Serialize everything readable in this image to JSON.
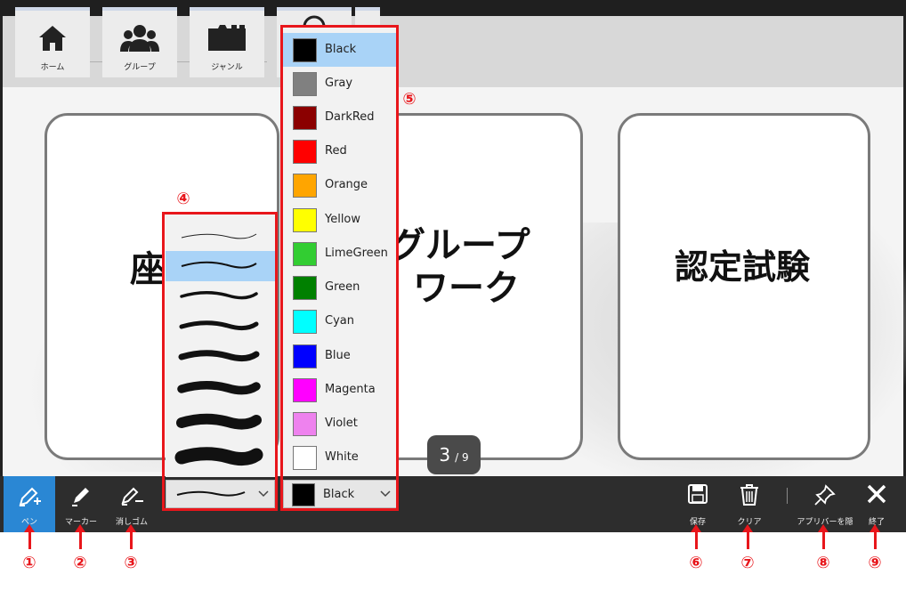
{
  "nav": {
    "home_label": "ホーム",
    "group_label": "グループ",
    "genre_label": "ジャンル"
  },
  "slide": {
    "card1_text": "座",
    "card2_line1": "グループ",
    "card2_line2": "ワーク",
    "card3_text": "認定試験"
  },
  "pager": {
    "current": "3",
    "total": "/ 9"
  },
  "toolbar": {
    "pen_label": "ペン",
    "marker_label": "マーカー",
    "eraser_label": "消しゴム",
    "save_label": "保存",
    "clear_label": "クリア",
    "hide_appbar_label": "アプリバーを隠",
    "exit_label": "終了"
  },
  "pen_width": {
    "selected_index": 1,
    "count": 8
  },
  "colors": {
    "selected": "Black",
    "dropdown_label": "Black",
    "items": [
      {
        "name": "Black",
        "hex": "#000000"
      },
      {
        "name": "Gray",
        "hex": "#808080"
      },
      {
        "name": "DarkRed",
        "hex": "#8b0000"
      },
      {
        "name": "Red",
        "hex": "#ff0000"
      },
      {
        "name": "Orange",
        "hex": "#ffa500"
      },
      {
        "name": "Yellow",
        "hex": "#ffff00"
      },
      {
        "name": "LimeGreen",
        "hex": "#32cd32"
      },
      {
        "name": "Green",
        "hex": "#008000"
      },
      {
        "name": "Cyan",
        "hex": "#00ffff"
      },
      {
        "name": "Blue",
        "hex": "#0000ff"
      },
      {
        "name": "Magenta",
        "hex": "#ff00ff"
      },
      {
        "name": "Violet",
        "hex": "#ee82ee"
      },
      {
        "name": "White",
        "hex": "#ffffff"
      }
    ]
  },
  "callouts": {
    "n1": "①",
    "n2": "②",
    "n3": "③",
    "n4": "④",
    "n5": "⑤",
    "n6": "⑥",
    "n7": "⑦",
    "n8": "⑧",
    "n9": "⑨"
  },
  "theme": {
    "accent": "#2a87d4",
    "callout_red": "#e8161b",
    "selection_blue": "#a9d3f7",
    "toolbar_bg": "#2d2d2d"
  }
}
